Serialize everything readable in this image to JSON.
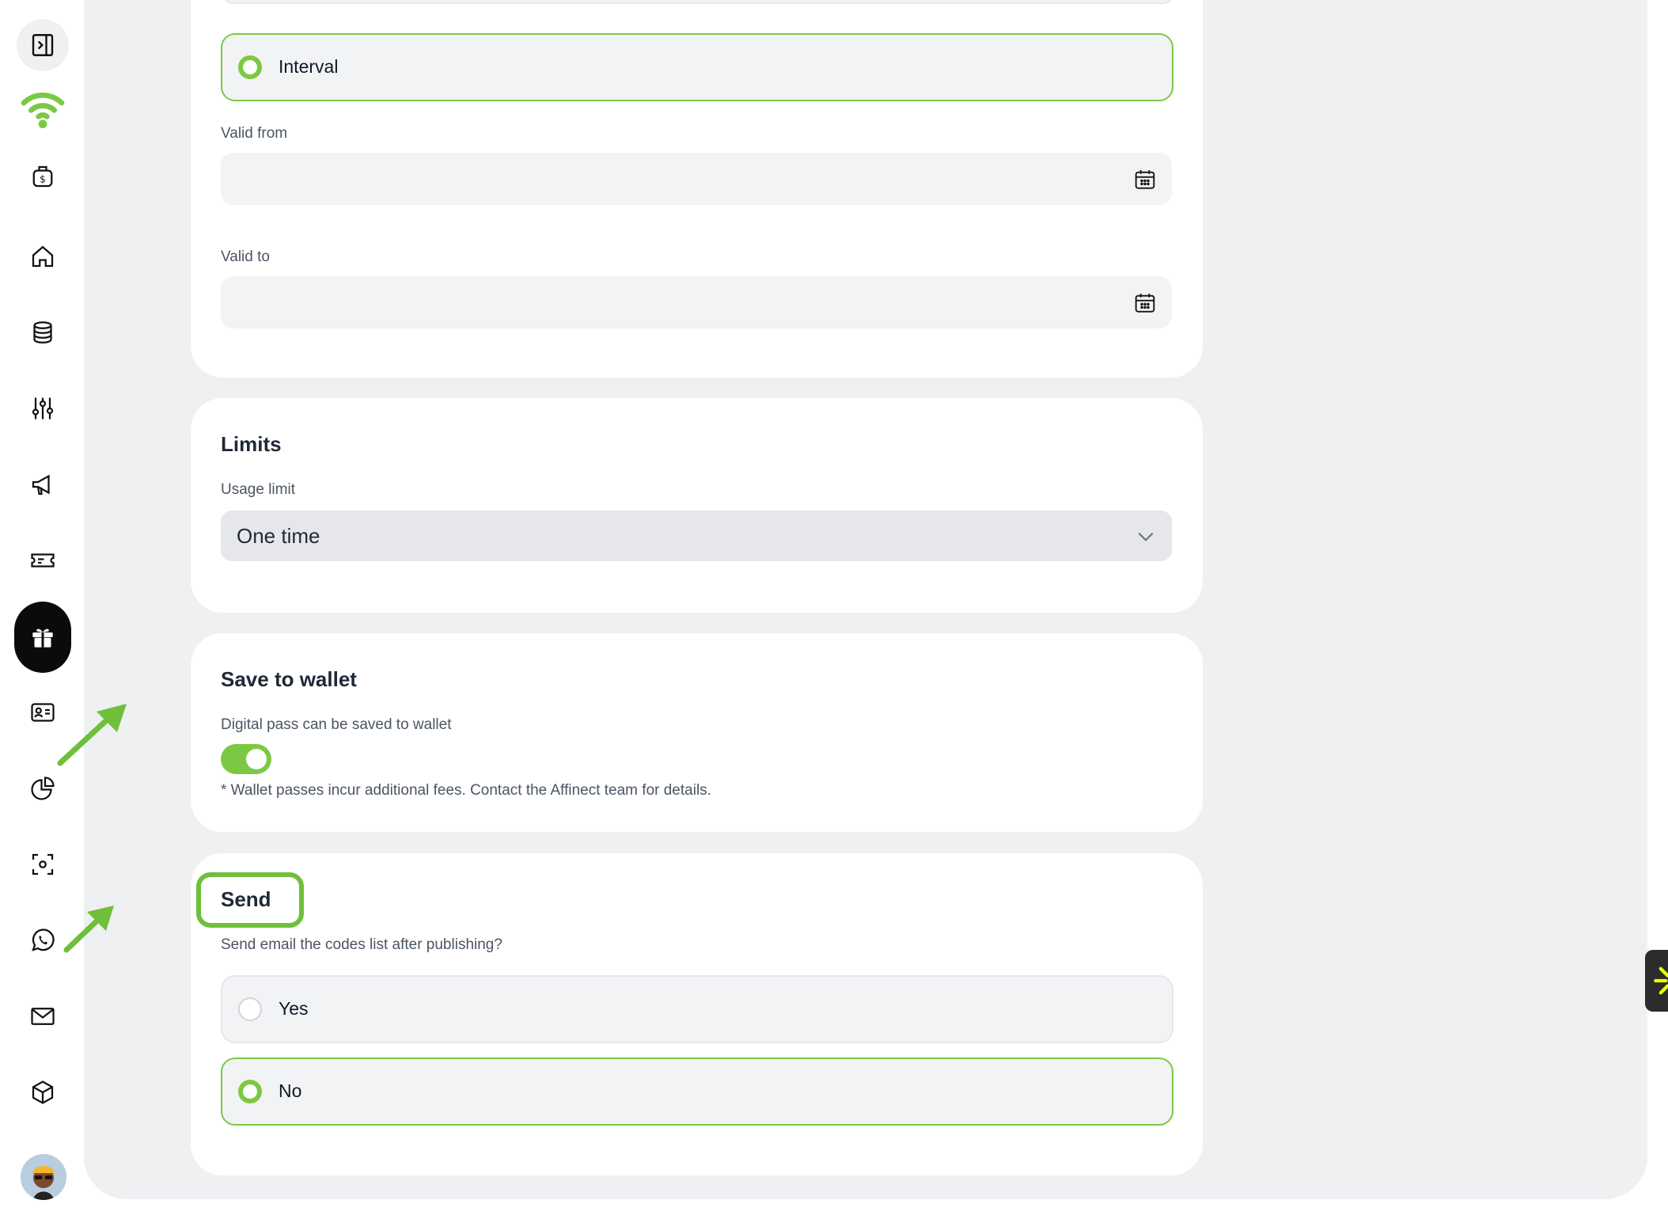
{
  "colors": {
    "accent": "#7bc943",
    "main_bg": "#eef0f2",
    "active_nav": "#0b0b0b",
    "widget_bg": "#2c2c2c",
    "widget_star": "#e6ff00"
  },
  "sidebar": {
    "toggle_icon": "sidebar-toggle-icon",
    "items": [
      {
        "name": "wifi-logo-icon"
      },
      {
        "name": "money-bag-icon"
      },
      {
        "name": "home-icon"
      },
      {
        "name": "database-icon"
      },
      {
        "name": "sliders-icon"
      },
      {
        "name": "megaphone-icon"
      },
      {
        "name": "ticket-icon"
      },
      {
        "name": "gift-icon",
        "active": true
      },
      {
        "name": "id-card-icon"
      },
      {
        "name": "pie-chart-icon"
      },
      {
        "name": "scan-icon"
      },
      {
        "name": "whatsapp-icon"
      },
      {
        "name": "mail-icon"
      },
      {
        "name": "box-icon"
      }
    ],
    "avatar": "user-avatar"
  },
  "validity": {
    "interval_option": "Interval",
    "valid_from_label": "Valid from",
    "valid_from_value": "",
    "valid_to_label": "Valid to",
    "valid_to_value": ""
  },
  "limits": {
    "title": "Limits",
    "usage_limit_label": "Usage limit",
    "usage_limit_value": "One time"
  },
  "wallet": {
    "title": "Save to wallet",
    "toggle_label": "Digital pass can be saved to wallet",
    "toggle_on": true,
    "note": "* Wallet passes incur additional fees. Contact the Affinect team for details."
  },
  "send": {
    "title": "Send",
    "question": "Send email the codes list after publishing?",
    "options": [
      {
        "label": "Yes",
        "selected": false
      },
      {
        "label": "No",
        "selected": true
      }
    ]
  },
  "widget": {
    "icon": "sparkle-icon"
  }
}
